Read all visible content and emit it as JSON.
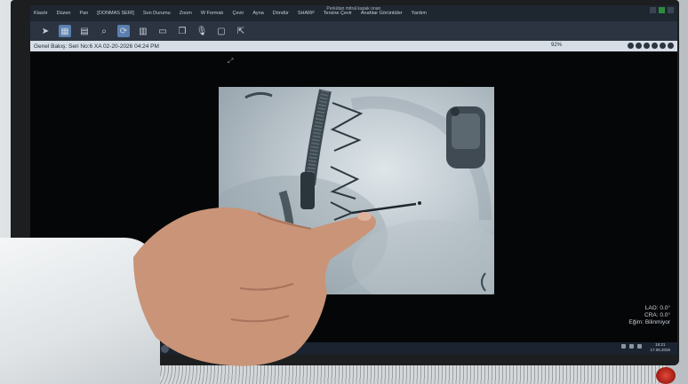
{
  "window": {
    "title": "Perkütan mitral kapak onarı"
  },
  "menu": {
    "items": [
      "Klasör",
      "Düzen",
      "Pan",
      "[DONMAS SERİ]",
      "Son Durumu",
      "Zoom",
      "W Formatı",
      "Çevir",
      "Ayna",
      "Döndür",
      "SHARP",
      "Tersine Çevir",
      "Anahtar Görüntüler",
      "Yardım"
    ]
  },
  "toolbar": {
    "icons": [
      "pointer-icon",
      "window-level-icon",
      "layout-icon",
      "zoom-icon",
      "rotate-icon",
      "film-icon",
      "measure-icon",
      "layers-icon",
      "microphone-icon",
      "display-icon",
      "export-icon"
    ]
  },
  "info": {
    "label": "Genel Bakış: Seri No:6  XA 02-20-2026 04:24 PM",
    "zoom": "92%"
  },
  "overlay": {
    "lines": [
      "LAO: 0.0°",
      "CRA: 0.0°",
      "Eğim: Bilinmiyor"
    ]
  },
  "taskbar": {
    "time": "15:21",
    "date": "17.06.2026"
  }
}
